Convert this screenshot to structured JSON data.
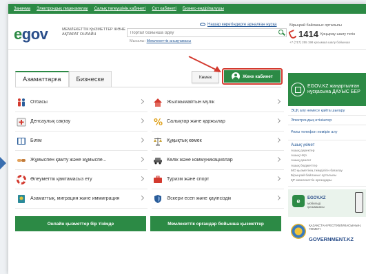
{
  "topbar": {
    "links": [
      "Заначма",
      "Электрондық лицензиялау",
      "Салық төлеушінің кабинеті",
      "Сот кабинеті",
      "Бизнес-ендіріпалушы"
    ]
  },
  "header": {
    "logo_main": "e",
    "logo_rest": "gov",
    "tagline": "МЕМЛЕКЕТТІК ҚЫЗМЕТТЕР ЖӘНЕ АҚПАРАТ ОНЛАЙН",
    "accessibility": "Нашар көретіндерге арналған нұсқа",
    "search_placeholder": "Портал бойынша іздеу",
    "hint_prefix": "Мысалы:",
    "hint_link": "Мемлекеттік анықтамасы",
    "callcenter": {
      "label": "Бірыңғай байланыс орталығы",
      "number": "1414",
      "free": "Қоңырау шалу тегін",
      "sub": "+7 (717) 255 198 қосымша шалу бойынша"
    }
  },
  "tabs": [
    {
      "label": "Азаматтарға",
      "active": true
    },
    {
      "label": "Бизнеске",
      "active": false
    }
  ],
  "actions": {
    "help": "Көмек",
    "cabinet": "Жеке кабинет"
  },
  "services": [
    {
      "label": "Отбасы",
      "icon": "family-icon"
    },
    {
      "label": "Жылжымайтын мүлік",
      "icon": "house-icon"
    },
    {
      "label": "Денсаулық сақтау",
      "icon": "health-icon"
    },
    {
      "label": "Салықтар және қаржылар",
      "icon": "percent-icon"
    },
    {
      "label": "Білім",
      "icon": "book-icon"
    },
    {
      "label": "Құқықтық көмек",
      "icon": "scales-icon"
    },
    {
      "label": "Жұмыспен қамту және жұмыспе...",
      "icon": "hands-icon"
    },
    {
      "label": "Көлік және коммуникациялар",
      "icon": "car-icon"
    },
    {
      "label": "Әлеуметтік қамтамасыз ету",
      "icon": "lifebuoy-icon"
    },
    {
      "label": "Туризм және спорт",
      "icon": "suitcase-icon"
    },
    {
      "label": "Азаматтық, миграция және иммиграция",
      "icon": "passport-icon"
    },
    {
      "label": "Әскери есеп және қауіпсіздік",
      "icon": "shield-icon"
    }
  ],
  "bottom_buttons": {
    "left": "Онлайн қызметтер бір тізімде",
    "right": "Мемлекеттік органдар бойынша қызметтер"
  },
  "right": {
    "vote": "EGOV.KZ жаңартылған нұсқасына ДАУЫС БЕР",
    "links": [
      "ЭЦҚ алу немесе қайта шығару",
      "Электрондық өтініштер",
      "Ұялы телефон нөмірін алу"
    ],
    "open_title": "Ашық үкімет",
    "open_items": [
      "Ашық деректер",
      "Ашық НҚА",
      "Ашық диалог",
      "Ашық бюджеттер",
      "МО қызметінің тиімділігін бағалау",
      "Бірыңғай байланыс орталығы",
      "ҚР мемлекеттік органдары"
    ],
    "app_icon": "e",
    "app_title": "EGOV.KZ",
    "app_sub": "мобильді қосымшасы",
    "gov_sub": "ҚАЗАҚСТАН РЕСПУБЛИКАСЫНЫҢ ҮКІМЕТІ",
    "gov_title": "GOVERNMENT.KZ"
  }
}
